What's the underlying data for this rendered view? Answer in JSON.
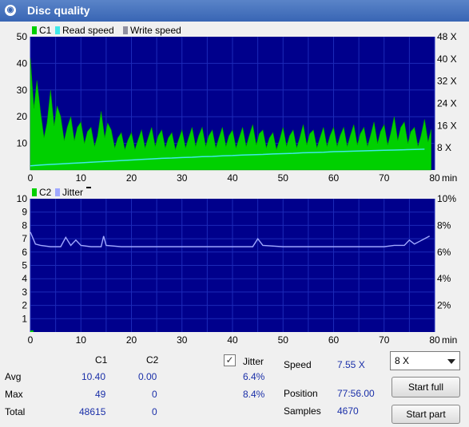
{
  "window": {
    "title": "Disc quality"
  },
  "chart_data": [
    {
      "type": "area",
      "legend": [
        "C1",
        "Read speed",
        "Write speed"
      ],
      "series_colors": {
        "C1": "#00d000",
        "Read speed": "#40e8e8",
        "Write speed": "#9090a0"
      },
      "xticks": [
        "0",
        "10",
        "20",
        "30",
        "40",
        "50",
        "60",
        "70",
        "80"
      ],
      "x_unit": "min",
      "ylim": [
        0,
        50
      ],
      "yticks": [
        "10",
        "20",
        "30",
        "40",
        "50"
      ],
      "y2ticks": [
        "8 X",
        "16 X",
        "24 X",
        "32 X",
        "40 X",
        "48 X"
      ],
      "x": [
        0,
        2,
        4,
        6,
        8,
        10,
        12,
        14,
        16,
        18,
        20,
        22,
        24,
        26,
        28,
        30,
        32,
        34,
        36,
        38,
        40,
        42,
        44,
        46,
        48,
        50,
        52,
        54,
        56,
        58,
        60,
        62,
        64,
        66,
        68,
        70,
        72,
        74,
        76,
        78
      ],
      "c1": [
        42,
        22,
        30,
        20,
        20,
        18,
        16,
        22,
        15,
        14,
        14,
        15,
        16,
        15,
        14,
        15,
        16,
        16,
        15,
        16,
        15,
        16,
        17,
        15,
        14,
        16,
        15,
        17,
        15,
        16,
        16,
        16,
        17,
        16,
        18,
        17,
        20,
        18,
        16,
        19
      ],
      "read_speed_x": [
        1.5,
        1.8,
        2.0,
        2.2,
        2.4,
        2.6,
        2.8,
        3.0,
        3.2,
        3.4,
        3.6,
        3.8,
        4.0,
        4.2,
        4.3,
        4.5,
        4.6,
        4.8,
        4.9,
        5.1,
        5.2,
        5.4,
        5.5,
        5.6,
        5.8,
        5.9,
        6.0,
        6.2,
        6.3,
        6.4,
        6.6,
        6.7,
        6.8,
        6.9,
        7.0,
        7.1,
        7.2,
        7.3,
        7.4,
        7.5
      ]
    },
    {
      "type": "line",
      "legend": [
        "C2",
        "Jitter"
      ],
      "series_colors": {
        "C2": "#00d000",
        "Jitter": "#a0a8ff"
      },
      "xticks": [
        "0",
        "10",
        "20",
        "30",
        "40",
        "50",
        "60",
        "70",
        "80"
      ],
      "x_unit": "min",
      "ylim": [
        0,
        10
      ],
      "yticks": [
        "1",
        "2",
        "3",
        "4",
        "5",
        "6",
        "7",
        "8",
        "9",
        "10"
      ],
      "y2ticks": [
        "2%",
        "4%",
        "6%",
        "8%",
        "10%"
      ],
      "x": [
        0,
        1,
        2,
        4,
        6,
        7,
        8,
        9,
        10,
        12,
        14,
        14.5,
        15,
        18,
        22,
        26,
        30,
        34,
        38,
        42,
        44,
        45,
        46,
        50,
        54,
        58,
        62,
        66,
        70,
        72,
        74,
        75,
        76,
        77,
        78,
        79
      ],
      "jitter": [
        7.5,
        6.6,
        6.5,
        6.4,
        6.4,
        7.1,
        6.5,
        6.9,
        6.5,
        6.4,
        6.4,
        7.2,
        6.5,
        6.4,
        6.4,
        6.4,
        6.4,
        6.4,
        6.4,
        6.4,
        6.4,
        7.0,
        6.5,
        6.4,
        6.4,
        6.4,
        6.4,
        6.4,
        6.4,
        6.5,
        6.5,
        6.9,
        6.6,
        6.8,
        7.0,
        7.2
      ]
    }
  ],
  "stats": {
    "headers": {
      "c1": "C1",
      "c2": "C2"
    },
    "rows": [
      {
        "label": "Avg",
        "c1": "10.40",
        "c2": "0.00",
        "jitter": "6.4%"
      },
      {
        "label": "Max",
        "c1": "49",
        "c2": "0",
        "jitter": "8.4%"
      },
      {
        "label": "Total",
        "c1": "48615",
        "c2": "0"
      }
    ],
    "jitter_label": "Jitter",
    "speed": {
      "label": "Speed",
      "value": "7.55 X"
    },
    "position": {
      "label": "Position",
      "value": "77:56.00"
    },
    "samples": {
      "label": "Samples",
      "value": "4670"
    }
  },
  "controls": {
    "speed_select": "8 X",
    "start_full": "Start full",
    "start_part": "Start part"
  }
}
